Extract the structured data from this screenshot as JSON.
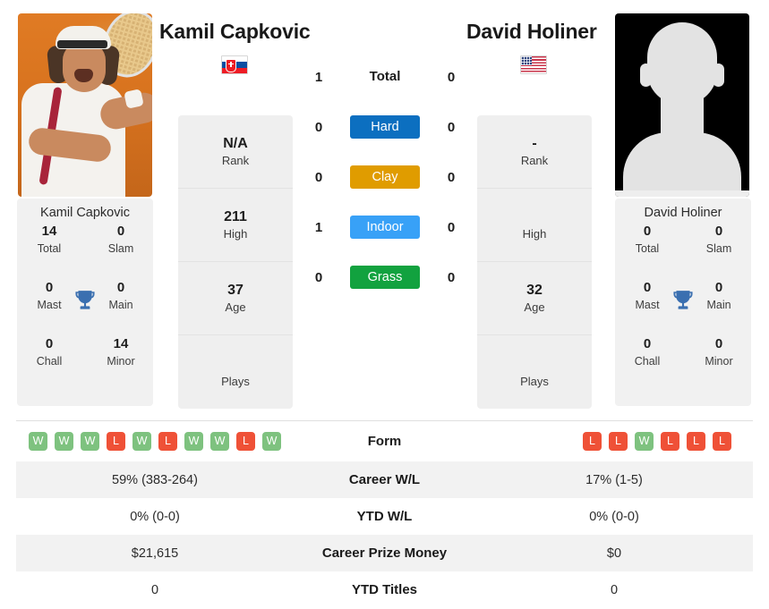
{
  "players": {
    "left": {
      "name": "Kamil Capkovic",
      "country_flag": "slovakia-flag",
      "photo": "player-photo-capkovic",
      "card_name": "Kamil Capkovic",
      "titles": [
        {
          "value": "14",
          "label": "Total"
        },
        {
          "value": "0",
          "label": "Slam"
        },
        {
          "value": "0",
          "label": "Mast"
        },
        {
          "value": "0",
          "label": "Main"
        },
        {
          "value": "0",
          "label": "Chall"
        },
        {
          "value": "14",
          "label": "Minor"
        }
      ],
      "info": [
        {
          "value": "N/A",
          "label": "Rank"
        },
        {
          "value": "211",
          "label": "High"
        },
        {
          "value": "37",
          "label": "Age"
        },
        {
          "value": "",
          "label": "Plays"
        }
      ],
      "form": [
        "W",
        "W",
        "W",
        "L",
        "W",
        "L",
        "W",
        "W",
        "L",
        "W"
      ],
      "career_wl": "59% (383-264)",
      "ytd_wl": "0% (0-0)",
      "career_prize_money": "$21,615",
      "ytd_titles": "0"
    },
    "right": {
      "name": "David Holiner",
      "country_flag": "usa-flag",
      "photo": "player-photo-placeholder",
      "card_name": "David Holiner",
      "titles": [
        {
          "value": "0",
          "label": "Total"
        },
        {
          "value": "0",
          "label": "Slam"
        },
        {
          "value": "0",
          "label": "Mast"
        },
        {
          "value": "0",
          "label": "Main"
        },
        {
          "value": "0",
          "label": "Chall"
        },
        {
          "value": "0",
          "label": "Minor"
        }
      ],
      "info": [
        {
          "value": "-",
          "label": "Rank"
        },
        {
          "value": "",
          "label": "High"
        },
        {
          "value": "32",
          "label": "Age"
        },
        {
          "value": "",
          "label": "Plays"
        }
      ],
      "form": [
        "L",
        "L",
        "W",
        "L",
        "L",
        "L"
      ],
      "career_wl": "17% (1-5)",
      "ytd_wl": "0% (0-0)",
      "career_prize_money": "$0",
      "ytd_titles": "0"
    }
  },
  "h2h": {
    "total": {
      "left": "1",
      "label": "Total",
      "right": "0"
    },
    "surfaces": [
      {
        "left": "0",
        "label": "Hard",
        "right": "0",
        "color": "#0c6fc0"
      },
      {
        "left": "0",
        "label": "Clay",
        "right": "0",
        "color": "#e09c00"
      },
      {
        "left": "1",
        "label": "Indoor",
        "right": "0",
        "color": "#38a1f7"
      },
      {
        "left": "0",
        "label": "Grass",
        "right": "0",
        "color": "#12a23f"
      }
    ]
  },
  "form_section": {
    "label": "Form",
    "win_color": "#7ec27f",
    "loss_color": "#ef5137"
  },
  "stats_rows": [
    {
      "label": "Career W/L",
      "left": "59% (383-264)",
      "right": "17% (1-5)"
    },
    {
      "label": "YTD W/L",
      "left": "0% (0-0)",
      "right": "0% (0-0)"
    },
    {
      "label": "Career Prize Money",
      "left": "$21,615",
      "right": "$0"
    },
    {
      "label": "YTD Titles",
      "left": "0",
      "right": "0"
    }
  ],
  "icons": {
    "trophy": "trophy-icon"
  }
}
